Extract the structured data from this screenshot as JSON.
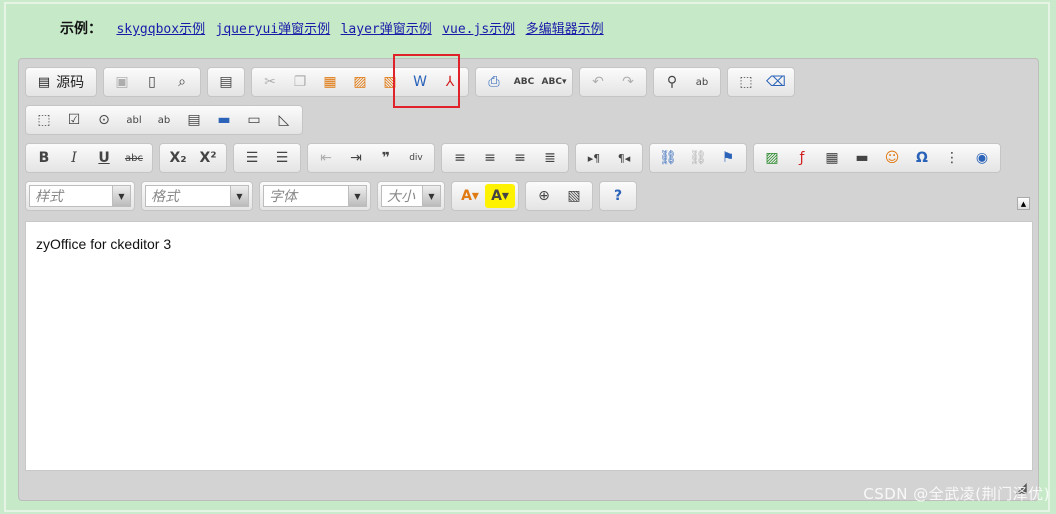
{
  "demo": {
    "label": "示例：",
    "links": [
      "skygqbox示例",
      "jqueryui弹窗示例",
      "layer弹窗示例",
      "vue.js示例",
      "多编辑器示例"
    ]
  },
  "toolbar": {
    "source_label": "源码",
    "style_placeholder": "样式",
    "format_placeholder": "格式",
    "font_placeholder": "字体",
    "size_placeholder": "大小"
  },
  "content": {
    "text": "zyOffice for ckeditor 3"
  },
  "watermark": "CSDN @全武凌(荆门泽优)",
  "colors": {
    "page_bg": "#c9ebcb",
    "highlight_border": "#e0222a",
    "link": "#1b1baa"
  }
}
